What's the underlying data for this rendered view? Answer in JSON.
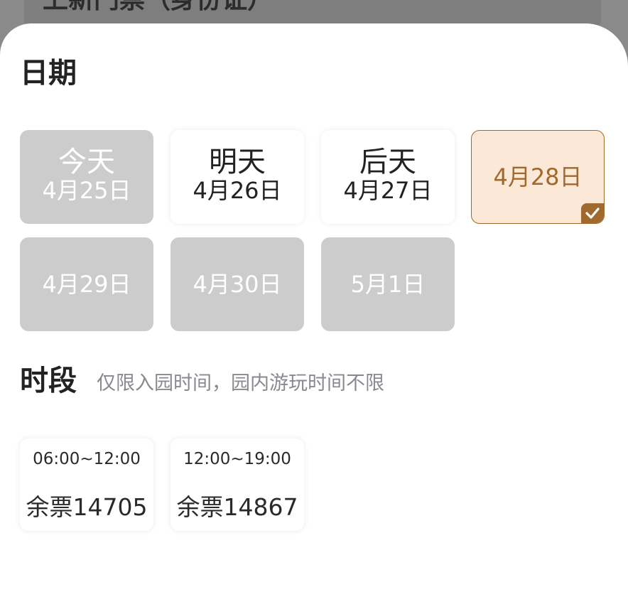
{
  "background": {
    "title": "上新门票（身份证）"
  },
  "date_section": {
    "title": "日期",
    "dates": [
      {
        "label": "今天",
        "date": "4月25日",
        "state": "disabled"
      },
      {
        "label": "明天",
        "date": "4月26日",
        "state": "available"
      },
      {
        "label": "后天",
        "date": "4月27日",
        "state": "available"
      },
      {
        "label": "",
        "date": "4月28日",
        "state": "selected"
      },
      {
        "label": "",
        "date": "4月29日",
        "state": "disabled"
      },
      {
        "label": "",
        "date": "4月30日",
        "state": "disabled"
      },
      {
        "label": "",
        "date": "5月1日",
        "state": "disabled"
      }
    ]
  },
  "slot_section": {
    "title": "时段",
    "note": "仅限入园时间，园内游玩时间不限",
    "slots": [
      {
        "time": "06:00~12:00",
        "stock": "余票14705"
      },
      {
        "time": "12:00~19:00",
        "stock": "余票14867"
      }
    ]
  },
  "colors": {
    "accent": "#a0692e",
    "selected_bg": "#fbe8d7",
    "disabled_bg": "#cccccc"
  },
  "icons": {
    "selected_badge": "check-icon"
  }
}
